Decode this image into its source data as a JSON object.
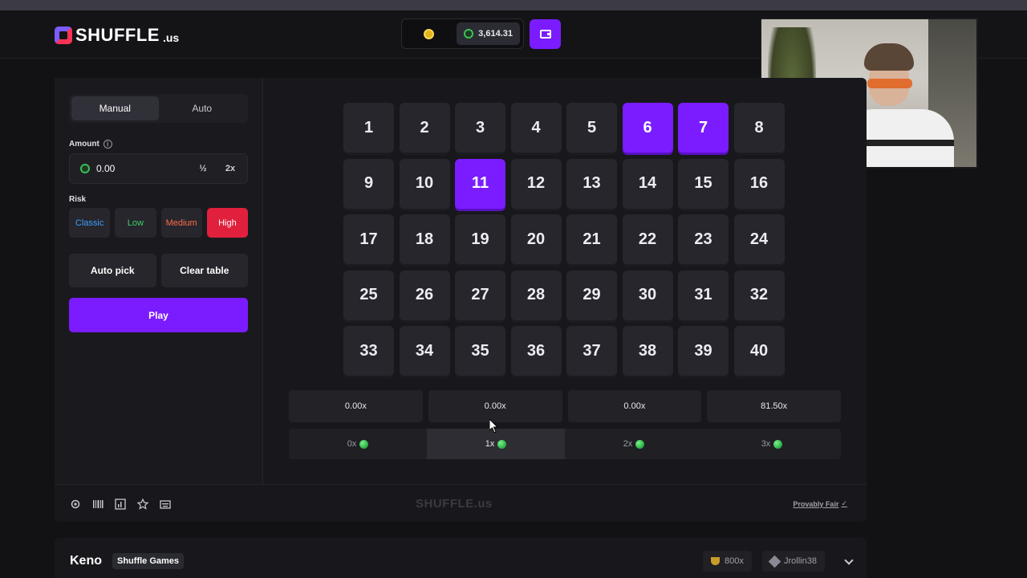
{
  "header": {
    "logo_text": "SHUFFLE",
    "logo_suffix": ".us",
    "balance": "3,614.31"
  },
  "sidebar": {
    "tabs": [
      "Manual",
      "Auto"
    ],
    "active_tab": "Manual",
    "amount_label": "Amount",
    "amount_value": "0.00",
    "half_label": "½",
    "double_label": "2x",
    "risk_label": "Risk",
    "risk_options": [
      "Classic",
      "Low",
      "Medium",
      "High"
    ],
    "risk_selected": "High",
    "risk_colors": {
      "Classic": "#3d9eff",
      "Low": "#3bd06a",
      "Medium": "#ff6a4a",
      "High": "#ffffff"
    },
    "auto_pick_label": "Auto pick",
    "clear_table_label": "Clear table",
    "play_label": "Play"
  },
  "board": {
    "numbers": [
      "1",
      "2",
      "3",
      "4",
      "5",
      "6",
      "7",
      "8",
      "9",
      "10",
      "11",
      "12",
      "13",
      "14",
      "15",
      "16",
      "17",
      "18",
      "19",
      "20",
      "21",
      "22",
      "23",
      "24",
      "25",
      "26",
      "27",
      "28",
      "29",
      "30",
      "31",
      "32",
      "33",
      "34",
      "35",
      "36",
      "37",
      "38",
      "39",
      "40"
    ],
    "selected": [
      "6",
      "7",
      "11"
    ]
  },
  "payouts": {
    "multipliers": [
      "0.00x",
      "0.00x",
      "0.00x",
      "81.50x"
    ],
    "hits": [
      "0x",
      "1x",
      "2x",
      "3x"
    ],
    "active_hit": "1x"
  },
  "footer": {
    "watermark": "SHUFFLE.us",
    "provably_fair": "Provably Fair",
    "icons": [
      "gear-icon",
      "barcode-icon",
      "chart-icon",
      "star-icon",
      "keyboard-icon"
    ]
  },
  "info_bar": {
    "game_title": "Keno",
    "provider": "Shuffle Games",
    "max_win": "800x",
    "top_user": "Jrollin38"
  },
  "colors": {
    "accent": "#7a1cff",
    "high_risk": "#e0203d",
    "coin": "#3bbf55"
  }
}
